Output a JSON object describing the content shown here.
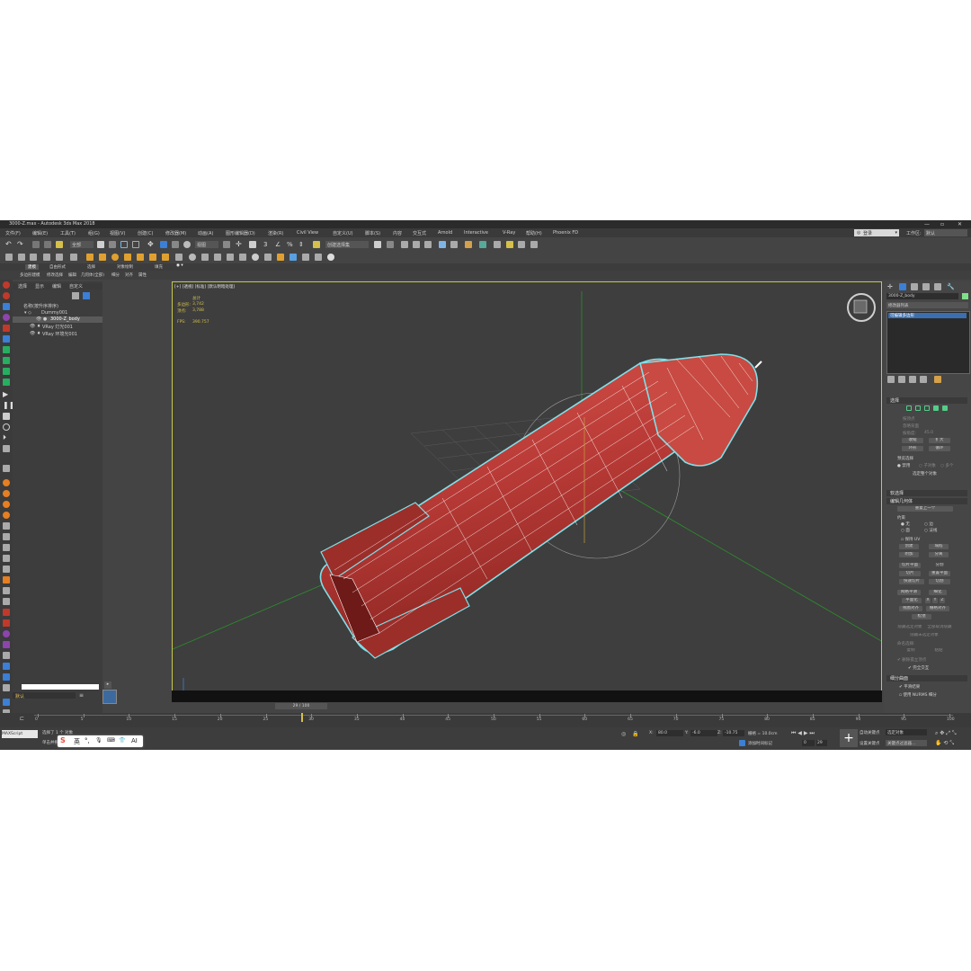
{
  "window": {
    "title": "3000-Z.max - Autodesk 3ds Max 2018",
    "controls": [
      "—",
      "▫",
      "✕"
    ]
  },
  "menu": [
    "文件(F)",
    "编辑(E)",
    "工具(T)",
    "组(G)",
    "视图(V)",
    "创建(C)",
    "修改器(M)",
    "动画(A)",
    "图形编辑器(D)",
    "渲染(R)",
    "Civil View",
    "自定义(U)",
    "脚本(S)",
    "内容",
    "交互式",
    "Arnold",
    "Interactive",
    "V-Ray",
    "帮助(H)",
    "Phoenix FD"
  ],
  "user": {
    "account": "登录",
    "workspace_label": "工作区:",
    "workspace_value": "默认"
  },
  "toolbar": {
    "filter": "全部",
    "view": "视图",
    "selection_set": "创建选择集"
  },
  "ribbon": {
    "tabs": [
      "建模",
      "自由形式",
      "选择",
      "对象绘制",
      "填充"
    ],
    "subtabs": [
      "多边形建模",
      "修改选择",
      "编辑",
      "几何体(全部)",
      "细分",
      "对齐",
      "属性"
    ]
  },
  "scene_explorer": {
    "tabs": [
      "选择",
      "显示",
      "编辑",
      "自定义"
    ],
    "header": "名称(按升序排序)",
    "items": [
      {
        "label": "Dummy001"
      },
      {
        "label": "3000-Z_body",
        "selected": true
      },
      {
        "label": "VRay 灯光001"
      },
      {
        "label": "VRay 环境光001"
      }
    ],
    "layer": "默认"
  },
  "viewport": {
    "label": "[+] [透视] [标准] [默认明暗处理]",
    "stats": {
      "total": "总计",
      "polys_label": "多边形:",
      "polys": "3,742",
      "verts_label": "顶点:",
      "verts": "3,788",
      "fps_label": "FPS:",
      "fps": "390.757"
    },
    "colors": {
      "mesh": "#b83a36",
      "wire": "#ffffff",
      "outline": "#7fe0e8",
      "grid": "#2d8f2d",
      "border": "#c8c84a"
    }
  },
  "command_panel": {
    "object_name": "3000-Z_body",
    "modifier_list": "修改器列表",
    "stack_item": "可编辑多边形",
    "selection_title": "选择",
    "selection_items": [
      "按顶点",
      "忽略背面",
      "按角度:",
      "45.0",
      "收缩",
      "扩大",
      "环形",
      "循环"
    ],
    "preview_title": "预览选择",
    "preview_options": [
      "禁用",
      "子对象",
      "多个"
    ],
    "select_whole": "选定整个对象",
    "soft_title": "软选择",
    "edit_geom_title": "编辑几何体",
    "repeat_last": "重复上一个",
    "constraint_label": "约束",
    "constraints": [
      "无",
      "边",
      "面",
      "法线"
    ],
    "preserve_uv": "保持 UV",
    "buttons": [
      "创建",
      "塌陷",
      "附加",
      "分离",
      "切片平面",
      "分割",
      "切片",
      "重置平面",
      "快速切片",
      "切割",
      "网格平滑",
      "细化",
      "平面化",
      "X",
      "Y",
      "Z",
      "视图对齐",
      "栅格对齐",
      "松弛",
      "隐藏选定对象",
      "全部取消隐藏",
      "隐藏未选定对象"
    ],
    "named_sel": "命名选择:",
    "copy": "复制",
    "paste": "粘贴",
    "delete_isolated": "删除孤立顶点",
    "full_interactive": "完全交互",
    "subdiv_title": "细分曲面",
    "smooth_result": "平滑结果",
    "use_nurms": "使用 NURMS 细分",
    "time_frame": "29 / 100"
  },
  "timeline": {
    "ticks": [
      "0",
      "5",
      "10",
      "15",
      "20",
      "25",
      "30",
      "35",
      "40",
      "45",
      "50",
      "55",
      "60",
      "65",
      "70",
      "75",
      "80",
      "85",
      "90",
      "95",
      "100"
    ],
    "current": 29,
    "max": 100
  },
  "status": {
    "script": "MAXScript",
    "selected": "选择了 1 个 对象",
    "hint": "单击并拖动",
    "x_label": "X:",
    "x": "80.0",
    "y_label": "Y:",
    "y": "-6.0",
    "z_label": "Z:",
    "z": "-10.75",
    "grid": "栅格 = 10.0cm",
    "added_time_tag": "添加时间标记",
    "auto_key": "自动关键点",
    "set_key": "设置关键点",
    "selected_obj": "选定对象",
    "key_filters": "关键点过滤器...",
    "frame_field": "0",
    "frame_field2": "29"
  },
  "ime": {
    "items": [
      "S",
      "英",
      "°,",
      "🎙",
      "⌨",
      "👕",
      "AI"
    ]
  }
}
